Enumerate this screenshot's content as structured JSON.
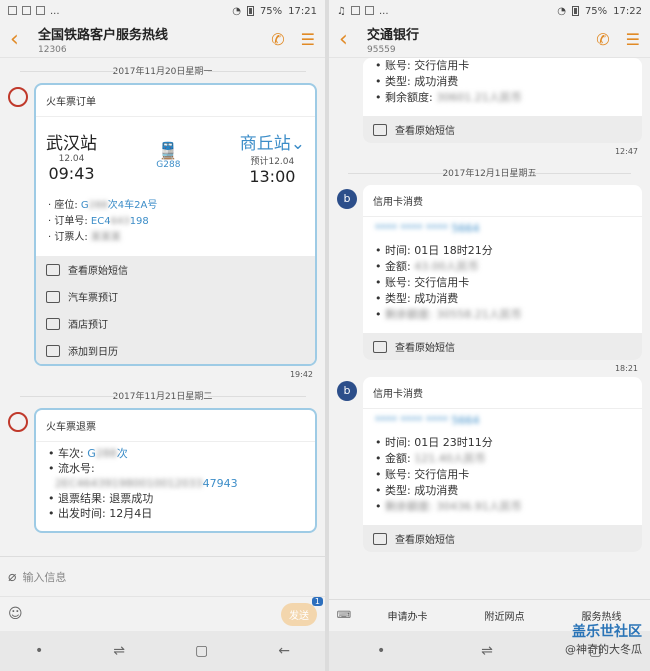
{
  "left": {
    "status": {
      "battery": "75%",
      "time": "17:21"
    },
    "header": {
      "title": "全国铁路客户服务热线",
      "subtitle": "12306"
    },
    "date1": "2017年11月20日星期一",
    "order_card": {
      "head": "火车票订单",
      "from": {
        "name": "武汉站",
        "date": "12.04",
        "time": "09:43"
      },
      "train": "G288",
      "to": {
        "name": "商丘站",
        "date": "预计12.04",
        "time": "13:00"
      },
      "seat_label": "座位:",
      "seat_value_suffix": "次4车2A号",
      "order_label": "订单号:",
      "order_suffix": "198",
      "booker_label": "订票人:",
      "actions": [
        "查看原始短信",
        "汽车票预订",
        "酒店预订",
        "添加到日历"
      ]
    },
    "time1": "19:42",
    "date2": "2017年11月21日星期二",
    "refund_card": {
      "head": "火车票退票",
      "train_label": "车次:",
      "train_suffix": "次",
      "serial_label": "流水号:",
      "serial_suffix": "47943",
      "result_label": "退票结果:",
      "result_value": "退票成功",
      "depart_label": "出发时间:",
      "depart_value": "12月4日"
    },
    "input_placeholder": "输入信息",
    "send_label": "发送",
    "send_badge": "1"
  },
  "right": {
    "status": {
      "battery": "75%",
      "time": "17:22"
    },
    "header": {
      "title": "交通银行",
      "subtitle": "95559"
    },
    "top_card": {
      "lines": [
        {
          "label": "账号:",
          "value": "交行信用卡"
        },
        {
          "label": "类型:",
          "value": "成功消费"
        },
        {
          "label": "剩余额度:",
          "value": ""
        }
      ],
      "action": "查看原始短信"
    },
    "time0": "12:47",
    "date1": "2017年12月1日星期五",
    "card1": {
      "head": "信用卡消费",
      "time_label": "时间:",
      "time_value": "01日 18时21分",
      "amount_label": "金额:",
      "account_label": "账号:",
      "account_value": "交行信用卡",
      "type_label": "类型:",
      "type_value": "成功消费",
      "action": "查看原始短信"
    },
    "time1": "18:21",
    "card2": {
      "head": "信用卡消费",
      "time_label": "时间:",
      "time_value": "01日 23时11分",
      "amount_label": "金额:",
      "account_label": "账号:",
      "account_value": "交行信用卡",
      "type_label": "类型:",
      "type_value": "成功消费",
      "action": "查看原始短信"
    },
    "menu": [
      "申请办卡",
      "附近网点",
      "服务热线"
    ]
  },
  "watermark": {
    "line1": "盖乐世社区",
    "line2": "@神奇的大冬瓜"
  }
}
